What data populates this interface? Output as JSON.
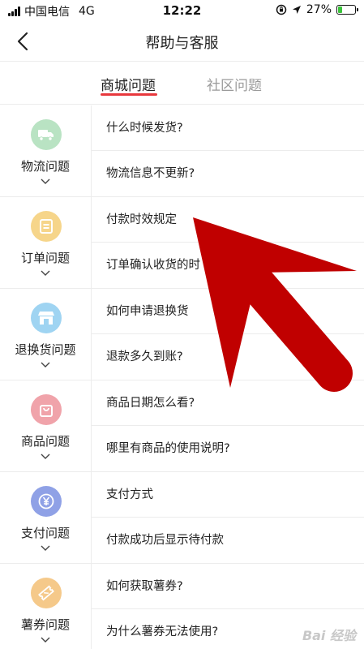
{
  "status_bar": {
    "carrier": "中国电信",
    "network": "4G",
    "time": "12:22",
    "battery_percent": "27%",
    "battery_level": 0.27
  },
  "nav": {
    "title": "帮助与客服"
  },
  "tabs": [
    {
      "label": "商城问题",
      "active": true
    },
    {
      "label": "社区问题",
      "active": false
    }
  ],
  "categories": [
    {
      "label": "物流问题",
      "icon": "truck-icon",
      "color": "#b9e3c3",
      "questions": [
        "什么时候发货?",
        "物流信息不更新?"
      ]
    },
    {
      "label": "订单问题",
      "icon": "order-icon",
      "color": "#f6d58a",
      "questions": [
        "付款时效规定",
        "订单确认收货的时"
      ]
    },
    {
      "label": "退换货问题",
      "icon": "shop-icon",
      "color": "#9fd4f2",
      "questions": [
        "如何申请退换货",
        "退款多久到账?"
      ]
    },
    {
      "label": "商品问题",
      "icon": "bag-icon",
      "color": "#f0a3aa",
      "questions": [
        "商品日期怎么看?",
        "哪里有商品的使用说明?"
      ]
    },
    {
      "label": "支付问题",
      "icon": "yen-icon",
      "color": "#8fa1e6",
      "questions": [
        "支付方式",
        "付款成功后显示待付款"
      ]
    },
    {
      "label": "薯券问题",
      "icon": "ticket-icon",
      "color": "#f5c98a",
      "questions": [
        "如何获取薯券?",
        "为什么薯券无法使用?"
      ]
    }
  ],
  "colors": {
    "accent": "#e8383d",
    "arrow": "#c00000"
  },
  "watermark": "Bai 经验"
}
